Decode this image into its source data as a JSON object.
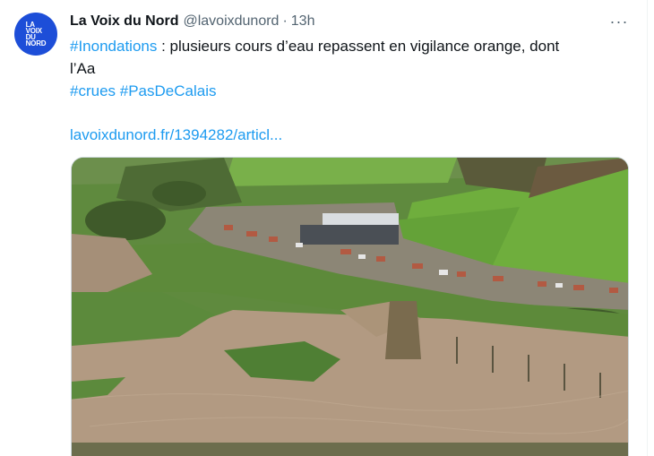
{
  "tweet": {
    "avatar_text": "LA\nVOIX\nDU\nNORD",
    "display_name": "La Voix du Nord",
    "handle": "@lavoixdunord",
    "separator": "·",
    "time": "13h",
    "more_label": "···",
    "hashtag1": "#Inondations",
    "text_part1": " : plusieurs cours d’eau repassent en vigilance orange, dont",
    "text_part2": "l’Aa",
    "hashtag2": "#crues",
    "hashtag3": "#PasDeCalais",
    "link": "lavoixdunord.fr/1394282/articl..."
  },
  "colors": {
    "link": "#1d9bf0",
    "secondary_text": "#536471",
    "avatar_bg": "#1d4ed8"
  },
  "media": {
    "description_icon": "aerial-flood-photo"
  }
}
